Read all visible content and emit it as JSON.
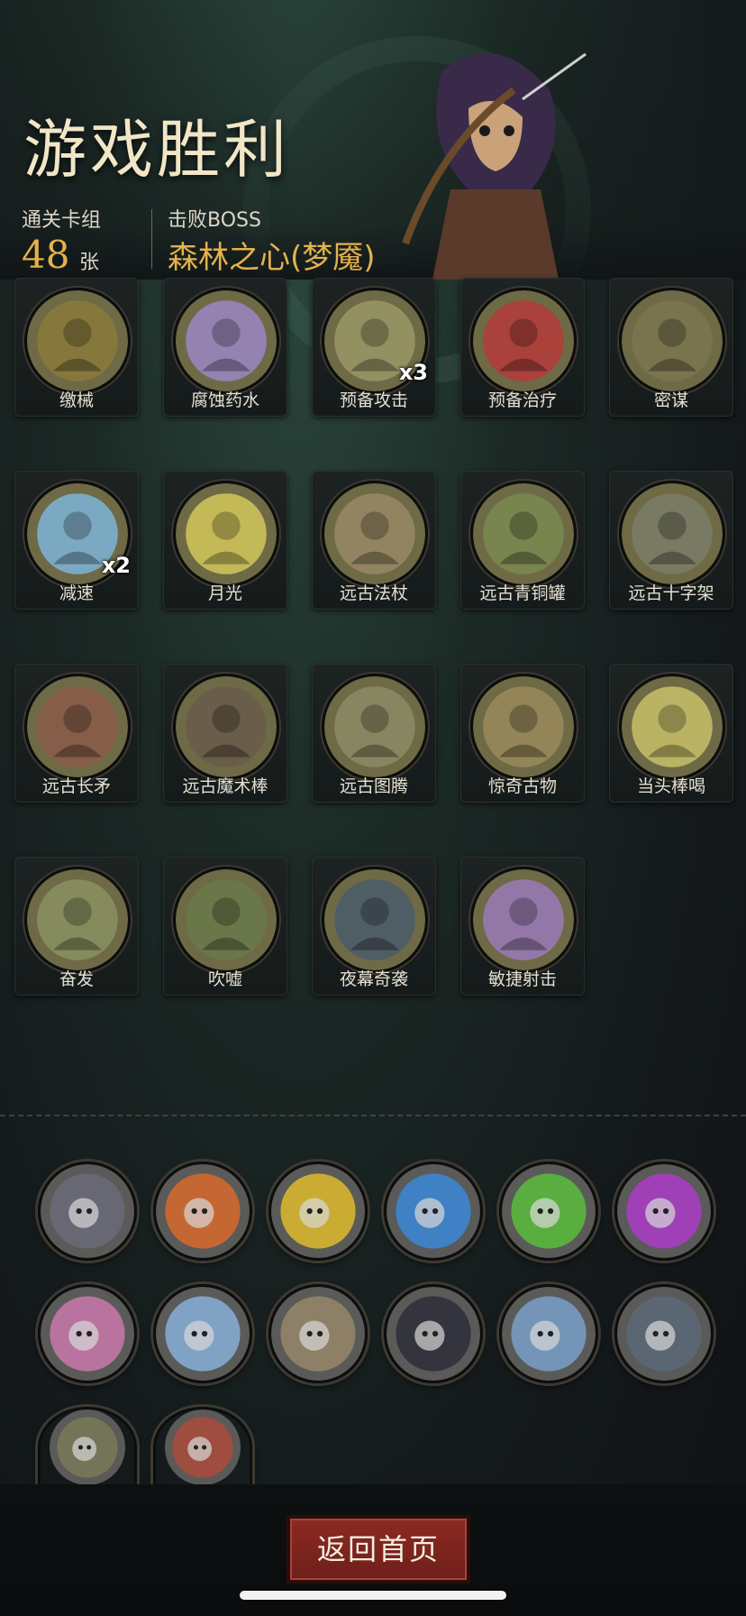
{
  "header": {
    "title": "游戏胜利",
    "deck_label": "通关卡组",
    "deck_count": "48",
    "deck_unit": "张",
    "boss_label": "击败BOSS",
    "boss_name": "森林之心(梦魇)"
  },
  "cards": [
    {
      "name": "缴械",
      "mult": "",
      "icon": "gears-card-icon",
      "color": "#8b7a3c"
    },
    {
      "name": "腐蚀药水",
      "mult": "",
      "icon": "potion-icon",
      "color": "#9b86c4"
    },
    {
      "name": "预备攻击",
      "mult": "x3",
      "icon": "goblin-icon",
      "color": "#9a9866"
    },
    {
      "name": "预备治疗",
      "mult": "",
      "icon": "heart-cross-icon",
      "color": "#b53a3a"
    },
    {
      "name": "密谋",
      "mult": "",
      "icon": "hooded-figures-icon",
      "color": "#7b7550"
    },
    {
      "name": "减速",
      "mult": "x2",
      "icon": "clock-ice-icon",
      "color": "#7fb4d8"
    },
    {
      "name": "月光",
      "mult": "",
      "icon": "moon-wolf-icon",
      "color": "#d2c75a"
    },
    {
      "name": "远古法杖",
      "mult": "",
      "icon": "staff-icon",
      "color": "#9a8866"
    },
    {
      "name": "远古青铜罐",
      "mult": "",
      "icon": "bronze-urn-icon",
      "color": "#7a8a50"
    },
    {
      "name": "远古十字架",
      "mult": "",
      "icon": "celtic-cross-icon",
      "color": "#7b7d68"
    },
    {
      "name": "远古长矛",
      "mult": "",
      "icon": "spear-icon",
      "color": "#8a5a4a"
    },
    {
      "name": "远古魔术棒",
      "mult": "",
      "icon": "wand-box-icon",
      "color": "#6a5a4a"
    },
    {
      "name": "远古图腾",
      "mult": "",
      "icon": "totem-icon",
      "color": "#8d8a66"
    },
    {
      "name": "惊奇古物",
      "mult": "",
      "icon": "explorer-icon",
      "color": "#9a8a5a"
    },
    {
      "name": "当头棒喝",
      "mult": "",
      "icon": "skull-strike-icon",
      "color": "#c8c06a"
    },
    {
      "name": "奋发",
      "mult": "",
      "icon": "fighter-icon",
      "color": "#8a9060"
    },
    {
      "name": "吹嘘",
      "mult": "",
      "icon": "bear-hunter-icon",
      "color": "#6a7a4a"
    },
    {
      "name": "夜幕奇袭",
      "mult": "",
      "icon": "night-ambush-icon",
      "color": "#4a5a6a"
    },
    {
      "name": "敏捷射击",
      "mult": "",
      "icon": "archer-icon",
      "color": "#9a7ab8"
    }
  ],
  "relics": [
    {
      "icon": "card-case-relic-icon",
      "color": "#6a6c7a"
    },
    {
      "icon": "fire-skull-music-relic-icon",
      "color": "#e06a2a"
    },
    {
      "icon": "gold-skull-music-relic-icon",
      "color": "#e6c02a"
    },
    {
      "icon": "blue-skull-music-relic-icon",
      "color": "#3a8ae0"
    },
    {
      "icon": "green-skull-music-relic-icon",
      "color": "#5ac23a"
    },
    {
      "icon": "purple-skull-music-relic-icon",
      "color": "#b03ad0"
    },
    {
      "icon": "pink-creature-relic-icon",
      "color": "#d07ab0"
    },
    {
      "icon": "ice-clock-relic-icon",
      "color": "#8ab4e0"
    },
    {
      "icon": "monk-fighter-relic-icon",
      "color": "#9a8a6a"
    },
    {
      "icon": "red-book-relic-icon",
      "color": "#2a2a3a"
    },
    {
      "icon": "ice-clock-2-relic-icon",
      "color": "#7aa4d0"
    },
    {
      "icon": "dagger-relic-icon",
      "color": "#5a6a7a"
    },
    {
      "icon": "wizard-relic-icon",
      "color": "#7a7a5a"
    },
    {
      "icon": "bloody-hands-relic-icon",
      "color": "#b04a3a"
    }
  ],
  "footer": {
    "home_button": "返回首页"
  }
}
